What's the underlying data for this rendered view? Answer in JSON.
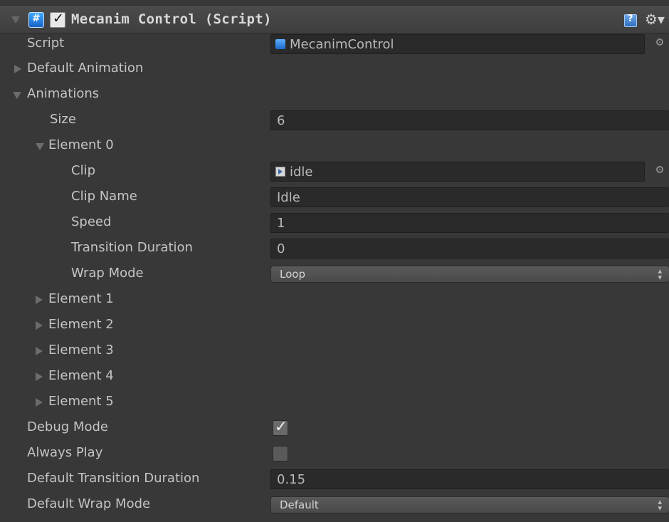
{
  "component": {
    "title": "Mecanim Control (Script)",
    "enabled": true,
    "icons": [
      "csharp-script-icon",
      "help-icon",
      "gear-icon"
    ]
  },
  "fields": {
    "script": {
      "label": "Script",
      "value": "MecanimControl"
    },
    "default_animation": {
      "label": "Default Animation"
    },
    "animations": {
      "label": "Animations",
      "size_label": "Size",
      "size_value": "6",
      "element0": {
        "label": "Element 0",
        "clip_label": "Clip",
        "clip_value": "idle",
        "clip_name_label": "Clip Name",
        "clip_name_value": "Idle",
        "speed_label": "Speed",
        "speed_value": "1",
        "transition_label": "Transition Duration",
        "transition_value": "0",
        "wrap_label": "Wrap Mode",
        "wrap_value": "Loop"
      },
      "collapsed_elements": [
        "Element 1",
        "Element 2",
        "Element 3",
        "Element 4",
        "Element 5"
      ]
    },
    "debug_mode": {
      "label": "Debug Mode",
      "checked": true
    },
    "always_play": {
      "label": "Always Play",
      "checked": false
    },
    "default_transition": {
      "label": "Default Transition Duration",
      "value": "0.15"
    },
    "default_wrap": {
      "label": "Default Wrap Mode",
      "value": "Default"
    }
  },
  "colors": {
    "background": "#383838",
    "field_bg": "#2a2a2a",
    "text": "#c4c4c4",
    "accent_blue": "#2f7fe0"
  }
}
